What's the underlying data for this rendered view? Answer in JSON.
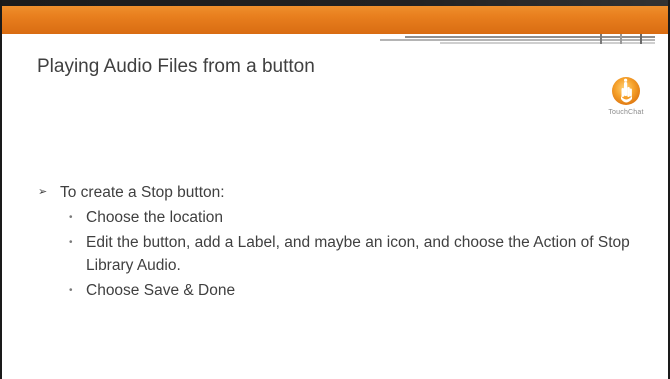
{
  "slide": {
    "title": "Playing Audio Files from a button",
    "logo": {
      "brand": "TouchChat",
      "icon": "touchchat-logo-icon"
    },
    "bullets": [
      {
        "text": "To create a Stop button:",
        "items": [
          "Choose the location",
          "Edit the button, add a Label, and maybe an icon, and choose the Action of Stop Library Audio.",
          "Choose Save & Done"
        ]
      }
    ],
    "colors": {
      "accent": "#e9801f",
      "text": "#404040"
    }
  }
}
